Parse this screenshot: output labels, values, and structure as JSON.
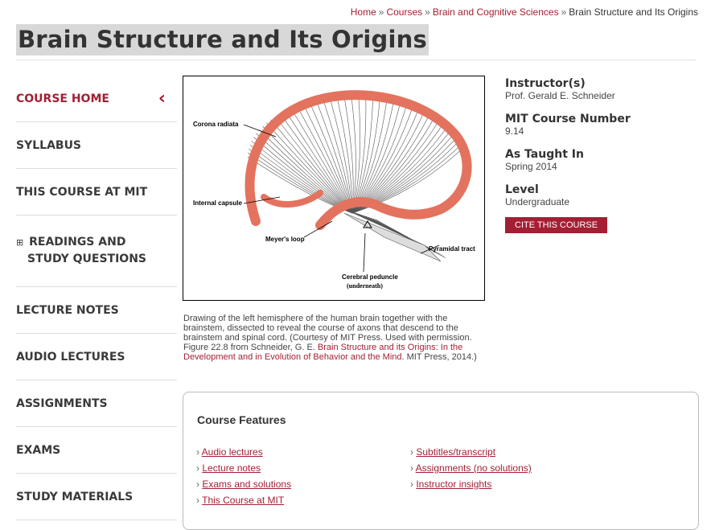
{
  "breadcrumb": {
    "items": [
      "Home",
      "Courses",
      "Brain and Cognitive Sciences"
    ],
    "separator": "»",
    "current": "Brain Structure and Its Origins"
  },
  "title": "Brain Structure and Its Origins",
  "nav": {
    "items": [
      {
        "label": "COURSE HOME",
        "active": true
      },
      {
        "label": "SYLLABUS"
      },
      {
        "label": "THIS COURSE AT MIT"
      },
      {
        "label": "READINGS AND STUDY QUESTIONS",
        "line1": "READINGS AND",
        "line2": "STUDY QUESTIONS",
        "expand": "⊞"
      },
      {
        "label": "LECTURE NOTES"
      },
      {
        "label": "AUDIO LECTURES"
      },
      {
        "label": "ASSIGNMENTS"
      },
      {
        "label": "EXAMS"
      },
      {
        "label": "STUDY MATERIALS"
      }
    ],
    "collapse_glyph": "‹"
  },
  "figure": {
    "labels": {
      "corona": "Corona radiata",
      "internal": "Internal capsule",
      "meyer": "Meyer's loop",
      "pyramidal": "Pyramidal tract",
      "peduncle": "Cerebral peduncle",
      "underneath": "(underneath)"
    }
  },
  "caption": {
    "text": "Drawing of the left hemisphere of the human brain together with the brainstem, dissected to reveal the course of axons that descend to the brainstem and spinal cord. (Courtesy of MIT Press. Used with permission. Figure 22.8 from Schneider, G. E. ",
    "link": "Brain Structure and its Origins: In the Development and in Evolution of Behavior and the Mind",
    "tail": ". MIT Press, 2014.)"
  },
  "info": {
    "instructor_label": "Instructor(s)",
    "instructor": "Prof. Gerald E. Schneider",
    "number_label": "MIT Course Number",
    "number": "9.14",
    "taught_label": "As Taught In",
    "taught": "Spring 2014",
    "level_label": "Level",
    "level": "Undergraduate",
    "cite": "CITE THIS COURSE"
  },
  "features": {
    "title": "Course Features",
    "bullet": "›",
    "col1": [
      "Audio lectures",
      "Lecture notes",
      "Exams and solutions",
      "This Course at MIT"
    ],
    "col2": [
      "Subtitles/transcript",
      "Assignments (no solutions)",
      "Instructor insights"
    ]
  },
  "colors": {
    "accent": "#a31f34",
    "title_bg": "#d8d8d8",
    "brain_outline": "#e3735e"
  }
}
